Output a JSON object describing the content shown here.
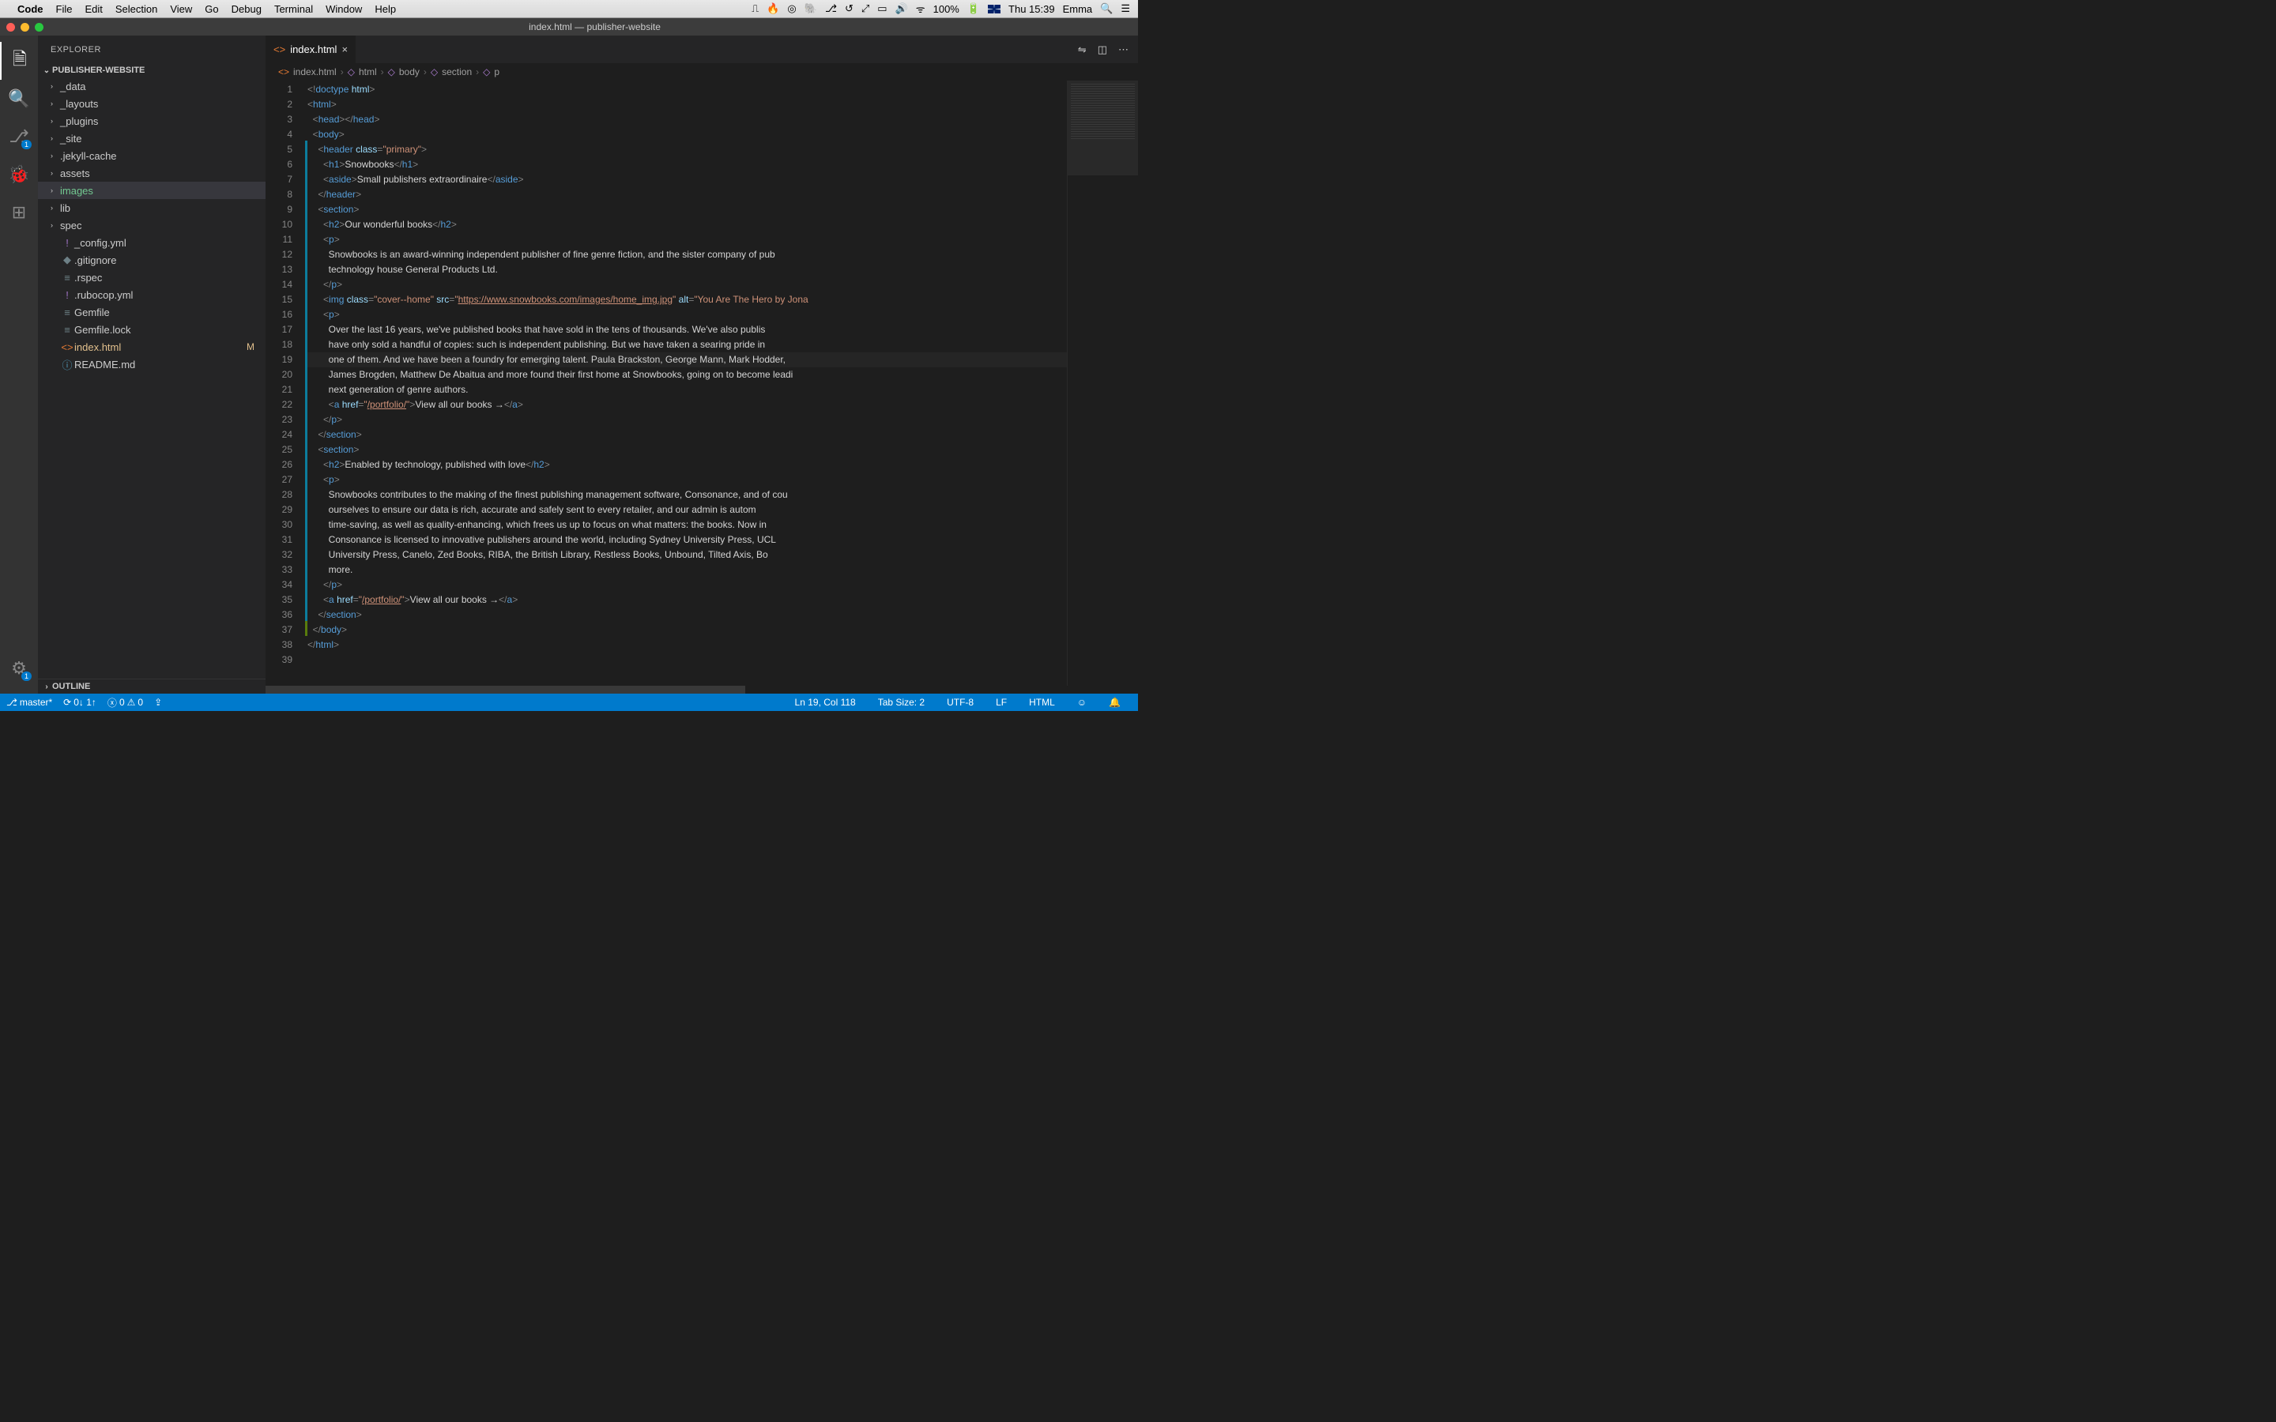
{
  "menubar": {
    "app": "Code",
    "items": [
      "File",
      "Edit",
      "Selection",
      "View",
      "Go",
      "Debug",
      "Terminal",
      "Window",
      "Help"
    ],
    "battery": "100%",
    "clock": "Thu 15:39",
    "user": "Emma"
  },
  "window": {
    "title": "index.html — publisher-website"
  },
  "activitybar": {
    "scm_badge": "1",
    "settings_badge": "1"
  },
  "sidebar": {
    "title": "EXPLORER",
    "project": "PUBLISHER-WEBSITE",
    "items": [
      {
        "kind": "folder",
        "name": "_data"
      },
      {
        "kind": "folder",
        "name": "_layouts"
      },
      {
        "kind": "folder",
        "name": "_plugins"
      },
      {
        "kind": "folder",
        "name": "_site"
      },
      {
        "kind": "folder",
        "name": ".jekyll-cache"
      },
      {
        "kind": "folder",
        "name": "assets"
      },
      {
        "kind": "folder",
        "name": "images",
        "selected": true,
        "git": "U"
      },
      {
        "kind": "folder",
        "name": "lib"
      },
      {
        "kind": "folder",
        "name": "spec"
      },
      {
        "kind": "file",
        "name": "_config.yml",
        "icon": "!",
        "iconcolor": "#a074c4"
      },
      {
        "kind": "file",
        "name": ".gitignore",
        "icon": "◆",
        "iconcolor": "#6d8086"
      },
      {
        "kind": "file",
        "name": ".rspec",
        "icon": "≡",
        "iconcolor": "#6d8086"
      },
      {
        "kind": "file",
        "name": ".rubocop.yml",
        "icon": "!",
        "iconcolor": "#a074c4"
      },
      {
        "kind": "file",
        "name": "Gemfile",
        "icon": "≡",
        "iconcolor": "#6d8086"
      },
      {
        "kind": "file",
        "name": "Gemfile.lock",
        "icon": "≡",
        "iconcolor": "#6d8086"
      },
      {
        "kind": "file",
        "name": "index.html",
        "icon": "<>",
        "iconcolor": "#e37933",
        "git": "M"
      },
      {
        "kind": "file",
        "name": "README.md",
        "icon": "ⓘ",
        "iconcolor": "#519aba"
      }
    ],
    "outline": "OUTLINE"
  },
  "tab": {
    "label": "index.html"
  },
  "breadcrumbs": [
    "index.html",
    "html",
    "body",
    "section",
    "p"
  ],
  "code": {
    "lines": [
      {
        "n": 1,
        "mod": "",
        "html": "<span class='t-punc'>&lt;!</span><span class='t-tag'>doctype</span> <span class='t-attr'>html</span><span class='t-punc'>&gt;</span>"
      },
      {
        "n": 2,
        "mod": "",
        "html": "<span class='t-punc'>&lt;</span><span class='t-tag'>html</span><span class='t-punc'>&gt;</span>"
      },
      {
        "n": 3,
        "mod": "",
        "html": "  <span class='t-punc'>&lt;</span><span class='t-tag'>head</span><span class='t-punc'>&gt;&lt;/</span><span class='t-tag'>head</span><span class='t-punc'>&gt;</span>"
      },
      {
        "n": 4,
        "mod": "",
        "html": "  <span class='t-punc'>&lt;</span><span class='t-tag'>body</span><span class='t-punc'>&gt;</span>"
      },
      {
        "n": 5,
        "mod": "chg",
        "html": "    <span class='t-punc'>&lt;</span><span class='t-tag'>header</span> <span class='t-attr'>class</span><span class='t-punc'>=</span><span class='t-str'>\"primary\"</span><span class='t-punc'>&gt;</span>"
      },
      {
        "n": 6,
        "mod": "chg",
        "html": "      <span class='t-punc'>&lt;</span><span class='t-tag'>h1</span><span class='t-punc'>&gt;</span><span class='t-txt'>Snowbooks</span><span class='t-punc'>&lt;/</span><span class='t-tag'>h1</span><span class='t-punc'>&gt;</span>"
      },
      {
        "n": 7,
        "mod": "chg",
        "html": "      <span class='t-punc'>&lt;</span><span class='t-tag'>aside</span><span class='t-punc'>&gt;</span><span class='t-txt'>Small publishers extraordinaire</span><span class='t-punc'>&lt;/</span><span class='t-tag'>aside</span><span class='t-punc'>&gt;</span>"
      },
      {
        "n": 8,
        "mod": "chg",
        "html": "    <span class='t-punc'>&lt;/</span><span class='t-tag'>header</span><span class='t-punc'>&gt;</span>"
      },
      {
        "n": 9,
        "mod": "chg",
        "html": "    <span class='t-punc'>&lt;</span><span class='t-tag'>section</span><span class='t-punc'>&gt;</span>"
      },
      {
        "n": 10,
        "mod": "chg",
        "html": "      <span class='t-punc'>&lt;</span><span class='t-tag'>h2</span><span class='t-punc'>&gt;</span><span class='t-txt'>Our wonderful books</span><span class='t-punc'>&lt;/</span><span class='t-tag'>h2</span><span class='t-punc'>&gt;</span>"
      },
      {
        "n": 11,
        "mod": "chg",
        "html": "      <span class='t-punc'>&lt;</span><span class='t-tag'>p</span><span class='t-punc'>&gt;</span>"
      },
      {
        "n": 12,
        "mod": "chg",
        "html": "        <span class='t-txt'>Snowbooks is an award-winning independent publisher of fine genre fiction, and the sister company of pub</span>"
      },
      {
        "n": 13,
        "mod": "chg",
        "html": "        <span class='t-txt'>technology house General Products Ltd.</span>"
      },
      {
        "n": 14,
        "mod": "chg",
        "html": "      <span class='t-punc'>&lt;/</span><span class='t-tag'>p</span><span class='t-punc'>&gt;</span>"
      },
      {
        "n": 15,
        "mod": "chg",
        "html": "      <span class='t-punc'>&lt;</span><span class='t-tag'>img</span> <span class='t-attr'>class</span><span class='t-punc'>=</span><span class='t-str'>\"cover--home\"</span> <span class='t-attr'>src</span><span class='t-punc'>=</span><span class='t-str'>\"</span><span class='t-link'>https://www.snowbooks.com/images/home_img.jpg</span><span class='t-str'>\"</span> <span class='t-attr'>alt</span><span class='t-punc'>=</span><span class='t-str'>\"You Are The Hero by Jona</span>"
      },
      {
        "n": 16,
        "mod": "chg",
        "html": "      <span class='t-punc'>&lt;</span><span class='t-tag'>p</span><span class='t-punc'>&gt;</span>"
      },
      {
        "n": 17,
        "mod": "chg",
        "html": "        <span class='t-txt'>Over the last 16 years, we've published books that have sold in the tens of thousands. We've also publis</span>"
      },
      {
        "n": 18,
        "mod": "chg",
        "html": "        <span class='t-txt'>have only sold a handful of copies: such is independent publishing. But we have taken a searing pride in</span>"
      },
      {
        "n": 19,
        "mod": "chg",
        "cursor": true,
        "html": "        <span class='t-txt'>one of them. And we have been a foundry for emerging talent. Paula Brackston, George Mann, Mark Hodder, </span>"
      },
      {
        "n": 20,
        "mod": "chg",
        "html": "        <span class='t-txt'>James Brogden, Matthew De Abaitua and more found their first home at Snowbooks, going on to become leadi</span>"
      },
      {
        "n": 21,
        "mod": "chg",
        "html": "        <span class='t-txt'>next generation of genre authors.</span>"
      },
      {
        "n": 22,
        "mod": "chg",
        "html": "        <span class='t-punc'>&lt;</span><span class='t-tag'>a</span> <span class='t-attr'>href</span><span class='t-punc'>=</span><span class='t-str'>\"</span><span class='t-link'>/portfolio/</span><span class='t-str'>\"</span><span class='t-punc'>&gt;</span><span class='t-txt'>View all our books →</span><span class='t-punc'>&lt;/</span><span class='t-tag'>a</span><span class='t-punc'>&gt;</span>"
      },
      {
        "n": 23,
        "mod": "chg",
        "html": "      <span class='t-punc'>&lt;/</span><span class='t-tag'>p</span><span class='t-punc'>&gt;</span>"
      },
      {
        "n": 24,
        "mod": "chg",
        "html": "    <span class='t-punc'>&lt;/</span><span class='t-tag'>section</span><span class='t-punc'>&gt;</span>"
      },
      {
        "n": 25,
        "mod": "chg",
        "html": "    <span class='t-punc'>&lt;</span><span class='t-tag'>section</span><span class='t-punc'>&gt;</span>"
      },
      {
        "n": 26,
        "mod": "chg",
        "html": "      <span class='t-punc'>&lt;</span><span class='t-tag'>h2</span><span class='t-punc'>&gt;</span><span class='t-txt'>Enabled by technology, published with love</span><span class='t-punc'>&lt;/</span><span class='t-tag'>h2</span><span class='t-punc'>&gt;</span>"
      },
      {
        "n": 27,
        "mod": "chg",
        "html": "      <span class='t-punc'>&lt;</span><span class='t-tag'>p</span><span class='t-punc'>&gt;</span>"
      },
      {
        "n": 28,
        "mod": "chg",
        "html": "        <span class='t-txt'>Snowbooks contributes to the making of the finest publishing management software, Consonance, and of cou</span>"
      },
      {
        "n": 29,
        "mod": "chg",
        "html": "        <span class='t-txt'>ourselves to ensure our data is rich, accurate and safely sent to every retailer, and our admin is autom</span>"
      },
      {
        "n": 30,
        "mod": "chg",
        "html": "        <span class='t-txt'>time-saving, as well as quality-enhancing, which frees us up to focus on what matters: the books. Now in</span>"
      },
      {
        "n": 31,
        "mod": "chg",
        "html": "        <span class='t-txt'>Consonance is licensed to innovative publishers around the world, including Sydney University Press, UCL</span>"
      },
      {
        "n": 32,
        "mod": "chg",
        "html": "        <span class='t-txt'>University Press, Canelo, Zed Books, RIBA, the British Library, Restless Books, Unbound, Tilted Axis, Bo</span>"
      },
      {
        "n": 33,
        "mod": "chg",
        "html": "        <span class='t-txt'>more.</span>"
      },
      {
        "n": 34,
        "mod": "chg",
        "html": "      <span class='t-punc'>&lt;/</span><span class='t-tag'>p</span><span class='t-punc'>&gt;</span>"
      },
      {
        "n": 35,
        "mod": "chg",
        "html": "      <span class='t-punc'>&lt;</span><span class='t-tag'>a</span> <span class='t-attr'>href</span><span class='t-punc'>=</span><span class='t-str'>\"</span><span class='t-link'>/portfolio/</span><span class='t-str'>\"</span><span class='t-punc'>&gt;</span><span class='t-txt'>View all our books →</span><span class='t-punc'>&lt;/</span><span class='t-tag'>a</span><span class='t-punc'>&gt;</span>"
      },
      {
        "n": 36,
        "mod": "chg",
        "html": "    <span class='t-punc'>&lt;/</span><span class='t-tag'>section</span><span class='t-punc'>&gt;</span>"
      },
      {
        "n": 37,
        "mod": "add",
        "html": "  <span class='t-punc'>&lt;/</span><span class='t-tag'>body</span><span class='t-punc'>&gt;</span>"
      },
      {
        "n": 38,
        "mod": "",
        "html": "<span class='t-punc'>&lt;/</span><span class='t-tag'>html</span><span class='t-punc'>&gt;</span>"
      },
      {
        "n": 39,
        "mod": "",
        "html": ""
      }
    ]
  },
  "statusbar": {
    "branch": "master*",
    "sync": "0↓ 1↑",
    "errors": "0",
    "warnings": "0",
    "cursor": "Ln 19, Col 118",
    "tabsize": "Tab Size: 2",
    "encoding": "UTF-8",
    "eol": "LF",
    "lang": "HTML"
  }
}
